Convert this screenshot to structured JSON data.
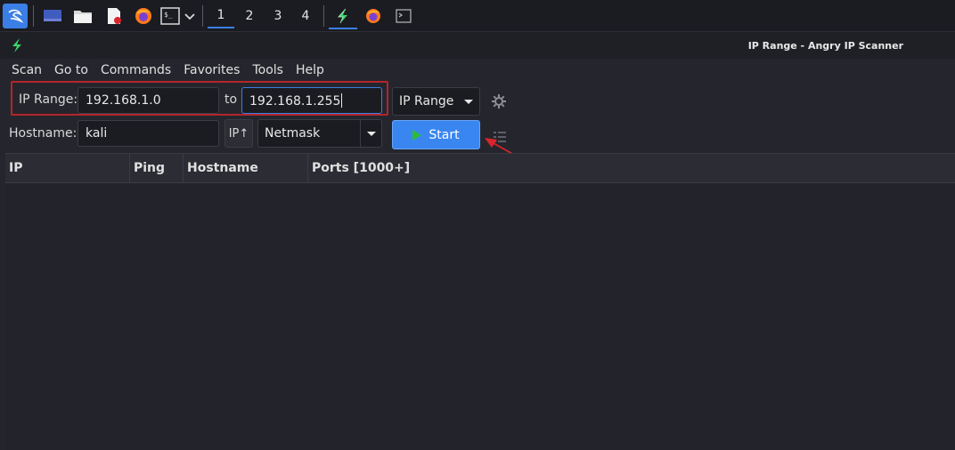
{
  "taskbar": {
    "workspaces": [
      "1",
      "2",
      "3",
      "4"
    ],
    "active_workspace": "1",
    "icons": [
      "kali-menu-icon",
      "desktop-icon",
      "files-icon",
      "text-editor-icon",
      "firefox-icon",
      "terminal-icon",
      "chevron-down-icon",
      "angry-ip-scanner-icon",
      "firefox-icon",
      "terminal-icon"
    ]
  },
  "window": {
    "title": "IP Range - Angry IP Scanner",
    "app_icon": "lightning-icon"
  },
  "menu": [
    "Scan",
    "Go to",
    "Commands",
    "Favorites",
    "Tools",
    "Help"
  ],
  "form": {
    "ip_range_label": "IP Range:",
    "ip_start": "192.168.1.0",
    "to_label": "to",
    "ip_end": "192.168.1.255",
    "feeder_select": "IP Range",
    "hostname_label": "Hostname:",
    "hostname": "kali",
    "ip_button": "IP↑",
    "netmask_select": "Netmask",
    "start_button": "Start"
  },
  "table": {
    "columns": [
      "IP",
      "Ping",
      "Hostname",
      "Ports [1000+]"
    ],
    "rows": []
  },
  "colors": {
    "highlight_box": "#b3262b",
    "annotation_arrow": "#d9252b",
    "start_button": "#3a86f0",
    "accent": "#3b7fe6"
  }
}
